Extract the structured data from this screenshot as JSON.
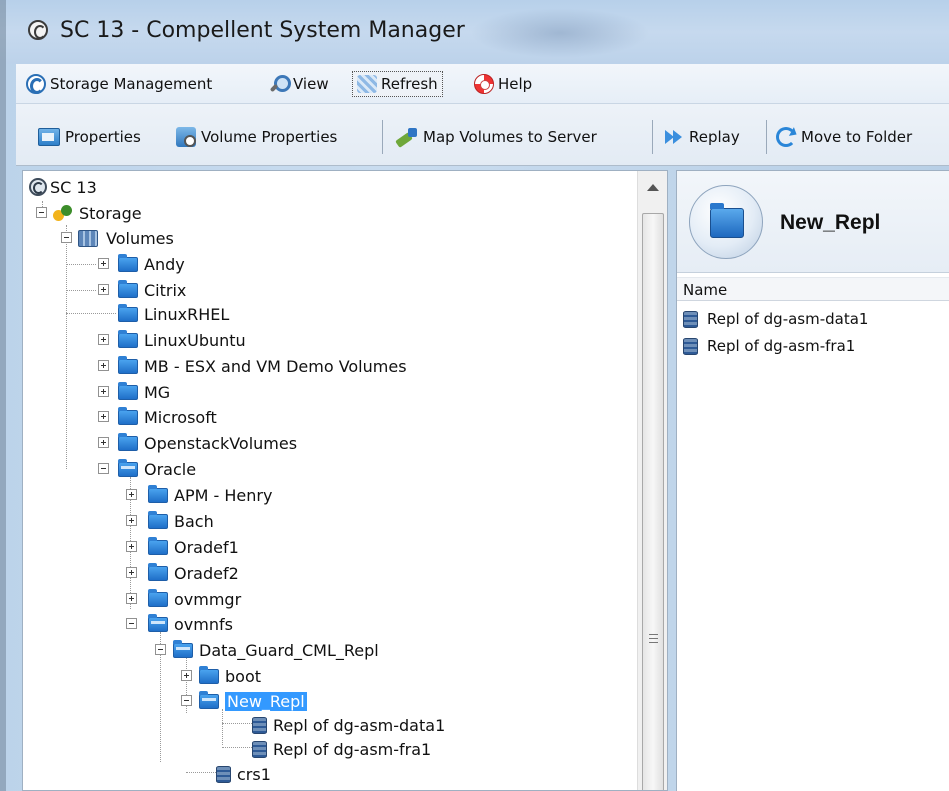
{
  "window": {
    "title": "SC 13 - Compellent System Manager"
  },
  "menubar": {
    "items": [
      {
        "label": "Storage Management",
        "icon": "storage-management-icon"
      },
      {
        "label": "View",
        "icon": "magnifier-icon"
      },
      {
        "label": "Refresh",
        "icon": "refresh-icon",
        "pressed": true
      },
      {
        "label": "Help",
        "icon": "help-icon"
      }
    ]
  },
  "toolbar": {
    "items": [
      {
        "label": "Properties",
        "icon": "properties-icon"
      },
      {
        "label": "Volume Properties",
        "icon": "volume-properties-icon"
      },
      {
        "label": "Map Volumes to Server",
        "icon": "map-volumes-icon"
      },
      {
        "label": "Replay",
        "icon": "replay-icon"
      },
      {
        "label": "Move to Folder",
        "icon": "move-to-folder-icon"
      }
    ]
  },
  "tree": {
    "root": "SC 13",
    "storage": "Storage",
    "volumes": "Volumes",
    "volume_folders": [
      "Andy",
      "Citrix",
      "LinuxRHEL",
      "LinuxUbuntu",
      "MB - ESX and VM Demo Volumes",
      "MG",
      "Microsoft",
      "OpenstackVolumes",
      "Oracle"
    ],
    "oracle_folders": [
      "APM - Henry",
      "Bach",
      "Oradef1",
      "Oradef2",
      "ovmmgr",
      "ovmnfs"
    ],
    "ovmnfs_child": "Data_Guard_CML_Repl",
    "dg_children": [
      "boot",
      "New_Repl"
    ],
    "new_repl_children": [
      "Repl of dg-asm-data1",
      "Repl of dg-asm-fra1"
    ],
    "last_visible": "crs1",
    "selected": "New_Repl"
  },
  "details": {
    "title": "New_Repl",
    "column_header": "Name",
    "rows": [
      "Repl of dg-asm-data1",
      "Repl of dg-asm-fra1"
    ]
  }
}
